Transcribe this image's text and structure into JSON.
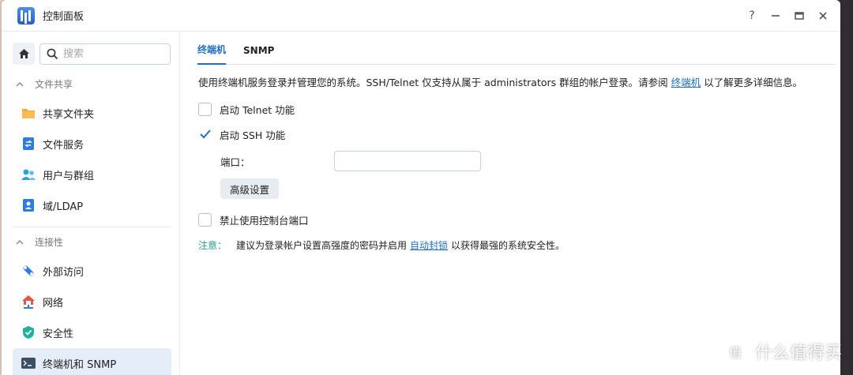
{
  "window": {
    "title": "控制面板",
    "controls": {
      "help": "?",
      "minimize": "minimize",
      "maximize": "maximize",
      "close": "close"
    }
  },
  "sidebar": {
    "search_placeholder": "搜索",
    "sections": [
      {
        "label": "文件共享",
        "items": [
          {
            "label": "共享文件夹",
            "icon": "shared-folder-icon"
          },
          {
            "label": "文件服务",
            "icon": "file-services-icon"
          },
          {
            "label": "用户与群组",
            "icon": "users-groups-icon"
          },
          {
            "label": "域/LDAP",
            "icon": "domain-ldap-icon"
          }
        ]
      },
      {
        "label": "连接性",
        "items": [
          {
            "label": "外部访问",
            "icon": "external-access-icon"
          },
          {
            "label": "网络",
            "icon": "network-icon"
          },
          {
            "label": "安全性",
            "icon": "security-icon"
          },
          {
            "label": "终端机和 SNMP",
            "icon": "terminal-icon",
            "active": true
          }
        ]
      }
    ]
  },
  "main": {
    "tabs": [
      {
        "label": "终端机",
        "active": true
      },
      {
        "label": "SNMP",
        "active": false
      }
    ],
    "description_prefix": "使用终端机服务登录并管理您的系统。SSH/Telnet 仅支持从属于 administrators 群组的帐户登录。请参阅",
    "description_link": "终端机",
    "description_suffix": "以了解更多详细信息。",
    "telnet_label": "启动 Telnet 功能",
    "telnet_checked": false,
    "ssh_label": "启动 SSH 功能",
    "ssh_checked": true,
    "port_label": "端口：",
    "port_value": "",
    "advanced_button": "高级设置",
    "console_label": "禁止使用控制台端口",
    "console_checked": false,
    "note_label": "注意：",
    "note_prefix": "建议为登录帐户设置高强度的密码并启用",
    "note_link": "自动封锁",
    "note_suffix": "以获得最强的系统安全性。"
  },
  "watermark": {
    "text": "什么值得买",
    "logo": "值"
  },
  "colors": {
    "accent": "#1f6fc5",
    "note": "#2a9d8f",
    "active_bg": "#e5edf8"
  }
}
